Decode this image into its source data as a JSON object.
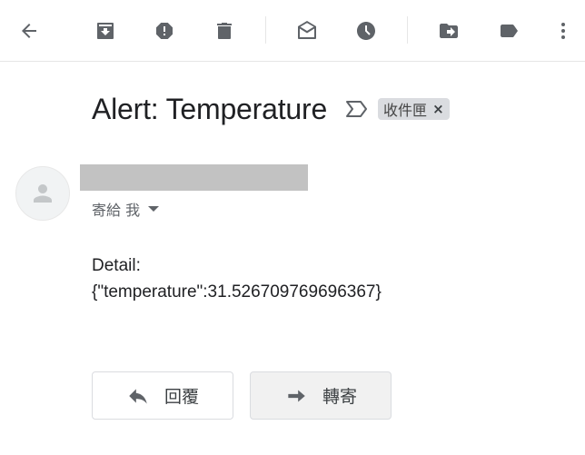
{
  "toolbar": {
    "back": "arrow-back-icon",
    "archive": "archive-icon",
    "spam": "report-spam-icon",
    "delete": "delete-icon",
    "mark_unread": "mark-unread-icon",
    "snooze": "snooze-icon",
    "move": "move-to-icon",
    "label": "label-icon",
    "more": "more-vert-icon"
  },
  "email": {
    "subject": "Alert: Temperature",
    "label_chip": "收件匣",
    "chip_close": "×",
    "to_line": "寄給 我",
    "body_line1": "Detail:",
    "body_line2": "{\"temperature\":31.526709769696367}"
  },
  "actions": {
    "reply": "回覆",
    "forward": "轉寄"
  }
}
